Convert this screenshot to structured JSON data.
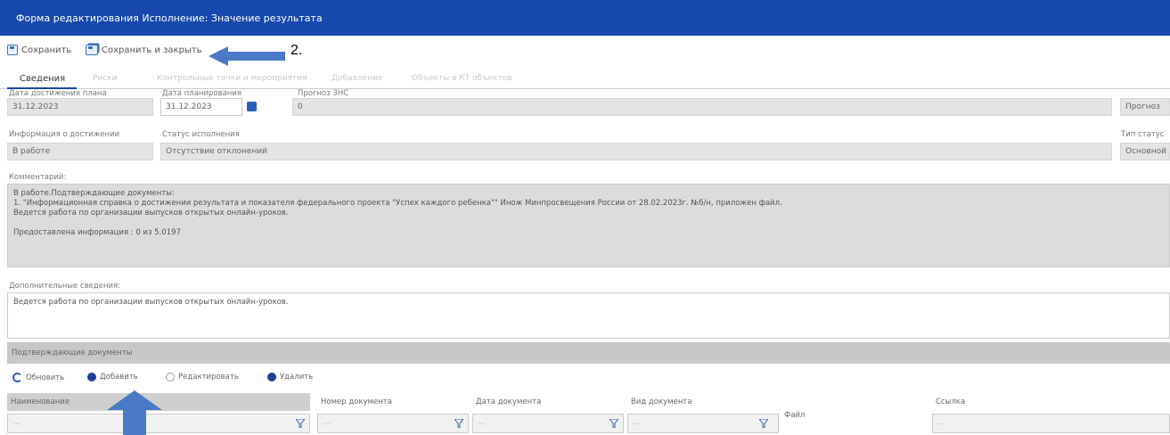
{
  "window": {
    "title": "Форма редактирования Исполнение: Значение результата"
  },
  "toolbar": {
    "save": "Сохранить",
    "save_close": "Сохранить и закрыть"
  },
  "annotation": {
    "step": "2.",
    "arrow_color": "#4a7ac7"
  },
  "tabs": [
    "Сведения",
    "Риски",
    "Контрольные точки и мероприятия",
    "Добавление",
    "Объекты в КТ объектов"
  ],
  "fields": {
    "date_achieved": {
      "label": "Дата достижения плана",
      "value": "31.12.2023"
    },
    "date_plan": {
      "label": "Дата планирования",
      "value": "31.12.2023"
    },
    "forecast_value": {
      "label": "Прогноз ЗНС",
      "value": "0"
    },
    "right_top": {
      "value": "Прогноз"
    },
    "achievement_info": {
      "label": "Информация о достижении",
      "value": "В работе"
    },
    "execution_status": {
      "label": "Статус исполнения",
      "value": "Отсутствие отклонений"
    },
    "status_type": {
      "label": "Тип статус",
      "value": "Основной"
    }
  },
  "comment": {
    "label": "Комментарий:",
    "lines": [
      "В работе.Подтверждающие документы:",
      "1. \"Информационная справка о достижении результата и показателя федерального проекта \"Успех каждого ребенка\"\" Инож Минпросвещения России от 28.02.2023г. №б/н, приложен файл.",
      "Ведется работа по организации выпусков открытых онлайн-уроков.",
      "",
      "Предоставлена информация : 0 из 5.0197"
    ]
  },
  "additional_info": {
    "label": "Дополнительные сведения:",
    "value": "Ведется работа по организации выпусков открытых онлайн-уроков."
  },
  "documents": {
    "section_title": "Подтверждающие документы",
    "actions": {
      "refresh": "Обновить",
      "add": "Добавить",
      "edit": "Редактировать",
      "delete": "Удалить"
    },
    "columns": [
      "Наименование",
      "Номер документа",
      "Дата документа",
      "Вид документа",
      "Файл",
      "Ссылка"
    ],
    "filter_placeholder": "..."
  },
  "colors": {
    "title_bar": "#1648ad",
    "accent": "#2f5eb8"
  }
}
